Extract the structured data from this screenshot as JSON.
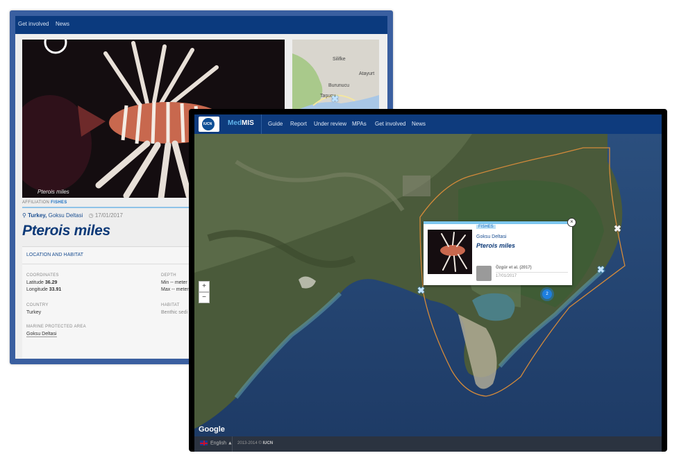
{
  "back_page": {
    "nav": [
      "Get involved",
      "News"
    ],
    "photo_caption": "Pterois miles",
    "minimap_labels": [
      "Silifke",
      "Atayurt",
      "Burunucu",
      "Taşucu"
    ],
    "affiliation_label": "AFFILIATION",
    "affiliation_value": "FISHES",
    "location_country": "Turkey,",
    "location_site": "Goksu Deltasi",
    "date": "17/01/2017",
    "species_title": "Pterois miles",
    "panel_heading": "LOCATION AND HABITAT",
    "coordinates_label": "COORDINATES",
    "latitude_label": "Latitude",
    "latitude_value": "36.29",
    "longitude_label": "Longitude",
    "longitude_value": "33.91",
    "depth_label": "DEPTH",
    "depth_min": "Min -- meter",
    "depth_max": "Max -- meter",
    "country_label": "COUNTRY",
    "country_value": "Turkey",
    "habitat_label": "HABITAT",
    "habitat_value": "Benthic sedi",
    "mpa_label": "MARINE PROTECTED AREA",
    "mpa_value": "Goksu Deltasi"
  },
  "front_page": {
    "logo_text": "IUCN",
    "brand_prefix": "Med",
    "brand_suffix": "MIS",
    "nav": [
      "Guide",
      "Report",
      "Under review",
      "MPAs",
      "Get involved",
      "News"
    ],
    "zoom_in": "+",
    "zoom_out": "−",
    "google_label": "Google",
    "cluster_count": "2",
    "popup": {
      "affiliation": "FISHES",
      "location": "Goksu Deltasi",
      "species": "Pterois miles",
      "author": "Özgür et al. (2017)",
      "date": "17/01/2017",
      "close": "×"
    },
    "footer_language": "English ▲",
    "footer_years": "2013-2014 ©",
    "footer_org": "IUCN"
  },
  "colors": {
    "nav_blue": "#0e3b7d",
    "title_blue": "#0d3a78",
    "accent_light_blue": "#7cc6ee",
    "mpa_outline": "#d48a3a"
  }
}
